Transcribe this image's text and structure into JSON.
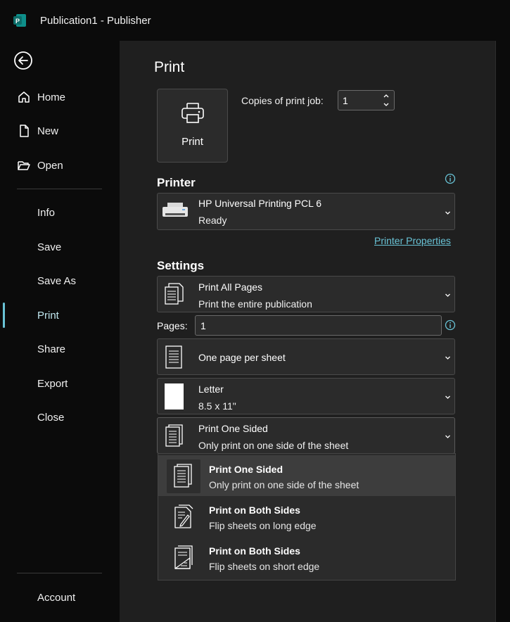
{
  "window": {
    "title": "Publication1 - Publisher",
    "app_icon": "publisher-icon"
  },
  "sidebar": {
    "back_icon": "back-arrow-icon",
    "items": [
      {
        "label": "Home",
        "icon": "home-icon"
      },
      {
        "label": "New",
        "icon": "new-document-icon"
      },
      {
        "label": "Open",
        "icon": "folder-open-icon"
      },
      {
        "label": "Info"
      },
      {
        "label": "Save"
      },
      {
        "label": "Save As"
      },
      {
        "label": "Print",
        "active": true
      },
      {
        "label": "Share"
      },
      {
        "label": "Export"
      },
      {
        "label": "Close"
      }
    ],
    "account_label": "Account",
    "accent_color": "#69c3d6"
  },
  "print": {
    "title": "Print",
    "button_label": "Print",
    "copies_label": "Copies of print job:",
    "copies_value": "1"
  },
  "printer": {
    "heading": "Printer",
    "name": "HP Universal Printing PCL 6",
    "status": "Ready",
    "properties_link": "Printer Properties"
  },
  "settings": {
    "heading": "Settings",
    "range": {
      "title": "Print All Pages",
      "subtitle": "Print the entire publication"
    },
    "pages_label": "Pages:",
    "pages_value": "1",
    "layout": {
      "title": "One page per sheet"
    },
    "paper": {
      "title": "Letter",
      "subtitle": "8.5 x 11\""
    },
    "sides": {
      "title": "Print One Sided",
      "subtitle": "Only print on one side of the sheet"
    }
  },
  "sides_menu": [
    {
      "title": "Print One Sided",
      "subtitle": "Only print on one side of the sheet",
      "selected": true,
      "icon": "one-sided-page-icon"
    },
    {
      "title": "Print on Both Sides",
      "subtitle": "Flip sheets on long edge",
      "selected": false,
      "icon": "flip-long-edge-icon"
    },
    {
      "title": "Print on Both Sides",
      "subtitle": "Flip sheets on short edge",
      "selected": false,
      "icon": "flip-short-edge-icon"
    }
  ]
}
